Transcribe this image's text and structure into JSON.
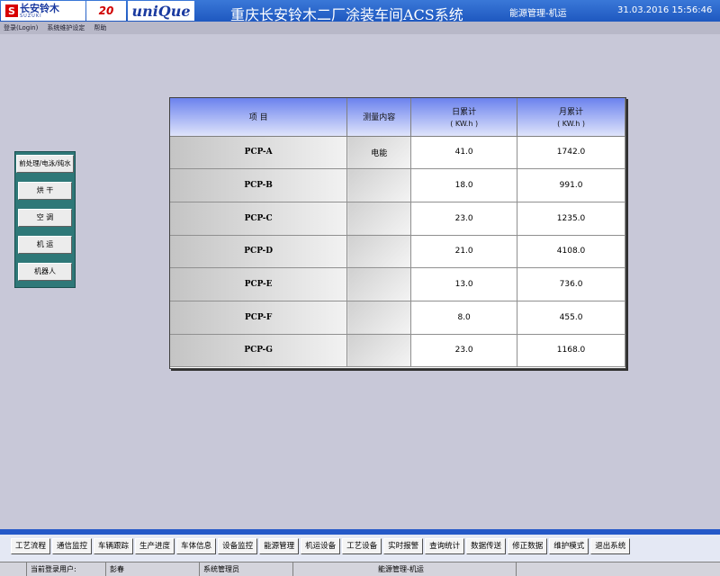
{
  "header": {
    "logo1_text": "长安铃木",
    "logo1_sub": "SUZUKI",
    "logo1_icon": "S",
    "logo2_text": "20",
    "logo3_text": "uniQue",
    "title": "重庆长安铃木二厂涂装车间ACS系统",
    "subtitle": "能源管理-机运",
    "datetime": "31.03.2016 15:56:46"
  },
  "menu": [
    "登录(Login)",
    "系统维护设定",
    "帮助"
  ],
  "left_panel": [
    "前处理/电泳/纯水",
    "烘 干",
    "空 调",
    "机 运",
    "机器人"
  ],
  "table": {
    "headers": {
      "item": "项  目",
      "content": "测量内容",
      "daily": "日累计",
      "daily_unit": "( KW.h )",
      "monthly": "月累计",
      "monthly_unit": "( KW.h )"
    },
    "rows": [
      {
        "item": "PCP-A",
        "content": "电能",
        "daily": "41.0",
        "monthly": "1742.0"
      },
      {
        "item": "PCP-B",
        "content": "",
        "daily": "18.0",
        "monthly": "991.0"
      },
      {
        "item": "PCP-C",
        "content": "",
        "daily": "23.0",
        "monthly": "1235.0"
      },
      {
        "item": "PCP-D",
        "content": "",
        "daily": "21.0",
        "monthly": "4108.0"
      },
      {
        "item": "PCP-E",
        "content": "",
        "daily": "13.0",
        "monthly": "736.0"
      },
      {
        "item": "PCP-F",
        "content": "",
        "daily": "8.0",
        "monthly": "455.0"
      },
      {
        "item": "PCP-G",
        "content": "",
        "daily": "23.0",
        "monthly": "1168.0"
      }
    ]
  },
  "toolbar": [
    "工艺流程",
    "通信监控",
    "车辆跟踪",
    "生产进度",
    "车体信息",
    "设备监控",
    "能源管理",
    "机运设备",
    "工艺设备",
    "实时报警",
    "查询统计",
    "数据传送",
    "修正数据",
    "维护模式",
    "退出系统"
  ],
  "status": {
    "user_label": "当前登录用户:",
    "user_name": "彭春",
    "role": "系统管理员",
    "page": "能源管理-机运"
  }
}
